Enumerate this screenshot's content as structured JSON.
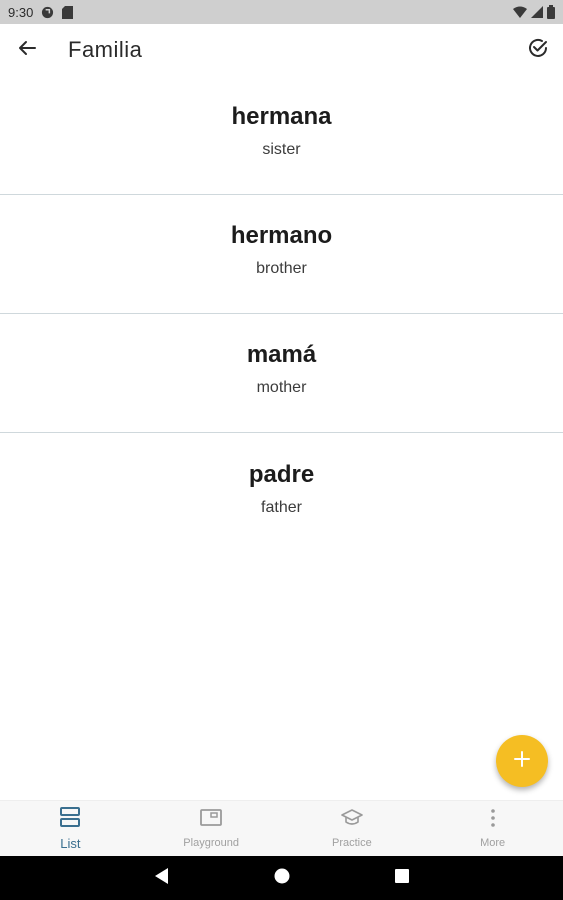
{
  "status_bar": {
    "time": "9:30",
    "icons_left": [
      "sync-icon",
      "sd-card-icon"
    ],
    "icons_right": [
      "wifi-icon",
      "cell-signal-icon",
      "battery-icon"
    ]
  },
  "app_bar": {
    "title": "Familia",
    "back_icon": "arrow-back-icon",
    "action_icon": "check-circle-icon"
  },
  "words": [
    {
      "term": "hermana",
      "translation": "sister"
    },
    {
      "term": "hermano",
      "translation": "brother"
    },
    {
      "term": "mamá",
      "translation": "mother"
    },
    {
      "term": "padre",
      "translation": "father"
    }
  ],
  "fab": {
    "icon": "plus-icon",
    "color": "#f5be23"
  },
  "bottom_nav": {
    "items": [
      {
        "label": "List",
        "icon": "list-icon",
        "active": true
      },
      {
        "label": "Playground",
        "icon": "playground-icon",
        "active": false
      },
      {
        "label": "Practice",
        "icon": "graduation-cap-icon",
        "active": false
      },
      {
        "label": "More",
        "icon": "more-vertical-icon",
        "active": false
      }
    ],
    "active_color": "#3a6f8f",
    "inactive_color": "#a0a0a0"
  },
  "system_nav": {
    "buttons": [
      "back-triangle-icon",
      "home-circle-icon",
      "recents-square-icon"
    ]
  }
}
